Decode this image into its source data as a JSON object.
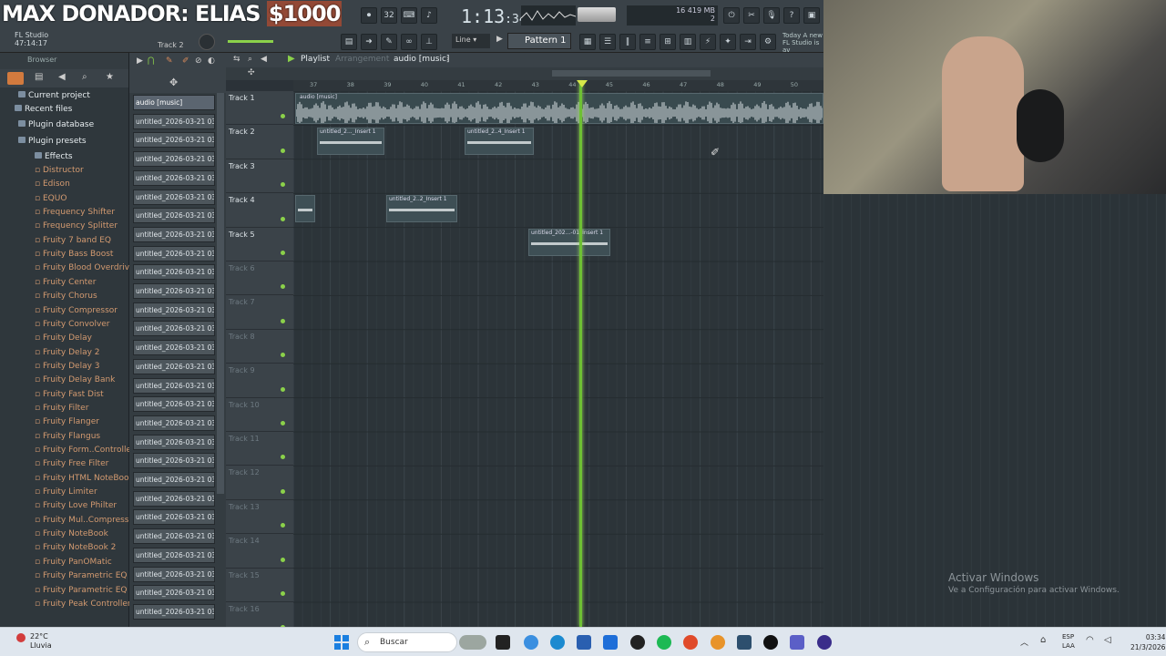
{
  "overlay": {
    "donor_text": "MAX DONADOR: ELIAS",
    "donor_amount": "$1000"
  },
  "toolbar": {
    "time": "1:13",
    "time_small": ":34",
    "app_name": "FL Studio",
    "app_time": "47:14:17",
    "track_hint": "Track 2",
    "snap": "Line",
    "pattern": "Pattern 1",
    "cpu_line1": "16    419 MB",
    "cpu_line2": "2",
    "news_line1": "Today  A new",
    "news_line2": "FL Studio is av"
  },
  "browser": {
    "title": "Browser",
    "folders": [
      "Current project",
      "Recent files",
      "Plugin database",
      "Plugin presets",
      "Effects"
    ],
    "plugins": [
      "Distructor",
      "Edison",
      "EQUO",
      "Frequency Shifter",
      "Frequency Splitter",
      "Fruity 7 band EQ",
      "Fruity Bass Boost",
      "Fruity Blood Overdrive",
      "Fruity Center",
      "Fruity Chorus",
      "Fruity Compressor",
      "Fruity Convolver",
      "Fruity Delay",
      "Fruity Delay 2",
      "Fruity Delay 3",
      "Fruity Delay Bank",
      "Fruity Fast Dist",
      "Fruity Filter",
      "Fruity Flanger",
      "Fruity Flangus",
      "Fruity Form..Controller",
      "Fruity Free Filter",
      "Fruity HTML NoteBook",
      "Fruity Limiter",
      "Fruity Love Philter",
      "Fruity Mul..Compressor",
      "Fruity NoteBook",
      "Fruity NoteBook 2",
      "Fruity PanOMatic",
      "Fruity Parametric EQ",
      "Fruity Parametric EQ 2",
      "Fruity Peak Controller"
    ]
  },
  "channels": [
    "audio [music]",
    "untitled_2026-03-21 03-",
    "untitled_2026-03-21 03-",
    "untitled_2026-03-21 03-",
    "untitled_2026-03-21 03-",
    "untitled_2026-03-21 03-",
    "untitled_2026-03-21 03-",
    "untitled_2026-03-21 03-",
    "untitled_2026-03-21 03-",
    "untitled_2026-03-21 03-",
    "untitled_2026-03-21 03-",
    "untitled_2026-03-21 03-",
    "untitled_2026-03-21 03-",
    "untitled_2026-03-21 03-",
    "untitled_2026-03-21 03-",
    "untitled_2026-03-21 03-",
    "untitled_2026-03-21 03-",
    "untitled_2026-03-21 03-",
    "untitled_2026-03-21 03-",
    "untitled_2026-03-21 03-",
    "untitled_2026-03-21 03-",
    "untitled_2026-03-21 03-",
    "untitled_2026-03-21 03-",
    "untitled_2026-03-21 03-",
    "untitled_2026-03-21 03-",
    "untitled_2026-03-21 03-",
    "untitled_2026-03-21 03-",
    "untitled_2026-03-21 03-"
  ],
  "playlist": {
    "title": "Playlist",
    "arrangement": "Arrangement",
    "current": "audio [music]",
    "bars": [
      "37",
      "38",
      "39",
      "40",
      "41",
      "42",
      "43",
      "44",
      "45",
      "46",
      "47",
      "48",
      "49",
      "50"
    ],
    "tracks": [
      "Track 1",
      "Track 2",
      "Track 3",
      "Track 4",
      "Track 5",
      "Track 6",
      "Track 7",
      "Track 8",
      "Track 9",
      "Track 10",
      "Track 11",
      "Track 12",
      "Track 13",
      "Track 14",
      "Track 15",
      "Track 16"
    ],
    "clips": [
      {
        "label": "audio [music]"
      },
      {
        "label": "untitled_2..._Insert 1"
      },
      {
        "label": "untitled_2..4_Insert 1"
      },
      {
        "label": "untitled_2..2_Insert 1"
      },
      {
        "label": "untitled_202...-01_Insert 1"
      }
    ]
  },
  "watermark": {
    "line1": "Activar Windows",
    "line2": "Ve a Configuración para activar Windows."
  },
  "taskbar": {
    "temp": "22°C",
    "weather": "Lluvia",
    "search": "Buscar",
    "lang1": "ESP",
    "lang2": "LAA",
    "time": "03:34",
    "date": "21/3/2026"
  }
}
